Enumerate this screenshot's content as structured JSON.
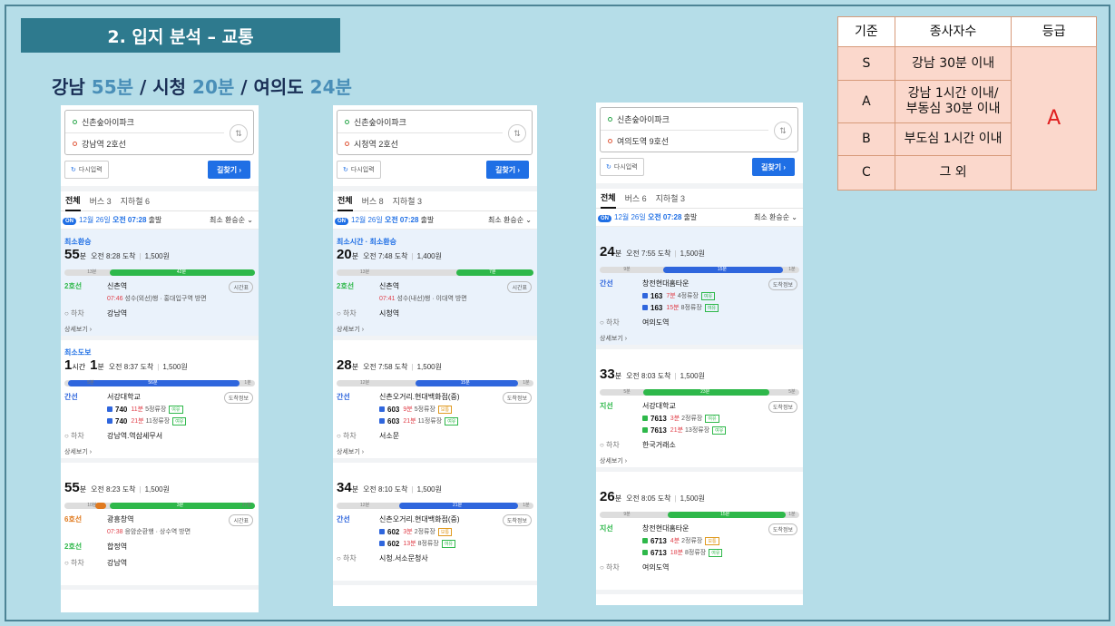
{
  "slide": {
    "title": "2. 입지 분석 – 교통",
    "summary": [
      {
        "name": "강남",
        "time": "55분",
        "sep": " / "
      },
      {
        "name": "시청",
        "time": "20분",
        "sep": " / "
      },
      {
        "name": "여의도",
        "time": "24분",
        "sep": ""
      }
    ]
  },
  "criteria": {
    "headers": [
      "기준",
      "종사자수",
      "등급"
    ],
    "rows": [
      {
        "level": "S",
        "desc": "강남 30분 이내"
      },
      {
        "level": "A",
        "desc": "강남 1시간 이내/ 부동심 30분 이내"
      },
      {
        "level": "B",
        "desc": "부도심 1시간 이내"
      },
      {
        "level": "C",
        "desc": "그 외"
      }
    ],
    "grade": "A"
  },
  "panels": [
    {
      "origin": "신촌숲아이파크",
      "destination": "강남역 2호선",
      "reset_label": "다시입력",
      "search_label": "길찾기 ›",
      "tabs": [
        "전체",
        "버스 3",
        "지하철 6"
      ],
      "on_badge": "ON",
      "date": "12월 26일",
      "time": "오전 07:28",
      "depart": "출발",
      "sort": "최소 환승순 ⌄",
      "routes": [
        {
          "tag": "최소환승",
          "num1": "55",
          "unit1": "분",
          "num2": "",
          "unit2": "",
          "arrive": "오전 8:28 도착",
          "fare": "1,500원",
          "bar_label_a": "13분",
          "bar_label_b": "42분",
          "steps": [
            {
              "line": "2호선",
              "station": "신촌역",
              "sub_red": "07:46",
              "sub": " 성수(외선)행 · 홍대입구역 방면",
              "pill": "시간표"
            },
            {
              "line": "○ 하차",
              "station": "강남역",
              "sub_red": "",
              "sub": "",
              "pill": ""
            }
          ],
          "more": "상세보기 ›"
        },
        {
          "tag": "최소도보",
          "num1": "1",
          "unit1": "시간",
          "num2": "1",
          "unit2": "분",
          "arrive": "오전 8:37 도착",
          "fare": "1,500원",
          "bar_label_a": "5분",
          "bar_label_b": "56분",
          "bar_label_c": "1분",
          "steps": [
            {
              "line": "간선",
              "station": "서강대학교",
              "sub_red": "",
              "sub": "",
              "pill": "도착정보",
              "buses": [
                {
                  "no": "740",
                  "min": "11분",
                  "info": "5정류장",
                  "tag": "여유"
                },
                {
                  "no": "740",
                  "min": "21분",
                  "info": "11정류장",
                  "tag": "여유"
                }
              ]
            },
            {
              "line": "○ 하차",
              "station": "강남역.역삼세무서",
              "sub_red": "",
              "sub": "",
              "pill": ""
            }
          ],
          "more": "상세보기 ›"
        },
        {
          "tag": "",
          "num1": "55",
          "unit1": "분",
          "num2": "",
          "unit2": "",
          "arrive": "오전 8:23 도착",
          "fare": "1,500원",
          "bar_label_a": "10분",
          "bar_label_b": "3분",
          "bar_label_c": "37분",
          "steps": [
            {
              "line": "6호선",
              "station": "광흥창역",
              "sub_red": "07:38",
              "sub": " 응암순환행 · 상수역 방면",
              "pill": "시간표"
            },
            {
              "line": "2호선",
              "station": "합정역",
              "sub_red": "",
              "sub": "",
              "pill": ""
            },
            {
              "line": "○ 하차",
              "station": "강남역",
              "sub_red": "",
              "sub": "",
              "pill": ""
            }
          ],
          "more": ""
        }
      ]
    },
    {
      "origin": "신촌숲아이파크",
      "destination": "시청역 2호선",
      "reset_label": "다시입력",
      "search_label": "길찾기 ›",
      "tabs": [
        "전체",
        "버스 8",
        "지하철 3"
      ],
      "on_badge": "ON",
      "date": "12월 26일",
      "time": "오전 07:28",
      "depart": "출발",
      "sort": "최소 환승순 ⌄",
      "routes": [
        {
          "tag": "최소시간 · 최소환승",
          "num1": "20",
          "unit1": "분",
          "num2": "",
          "unit2": "",
          "arrive": "오전 7:48 도착",
          "fare": "1,400원",
          "bar_label_a": "13분",
          "bar_label_b": "7분",
          "steps": [
            {
              "line": "2호선",
              "station": "신촌역",
              "sub_red": "07:41",
              "sub": " 성수(내선)행 · 이대역 방면",
              "pill": "시간표"
            },
            {
              "line": "○ 하차",
              "station": "시청역",
              "sub_red": "",
              "sub": "",
              "pill": ""
            }
          ],
          "more": "상세보기 ›"
        },
        {
          "tag": "",
          "num1": "28",
          "unit1": "분",
          "num2": "",
          "unit2": "",
          "arrive": "오전 7:58 도착",
          "fare": "1,500원",
          "bar_label_a": "12분",
          "bar_label_b": "15분",
          "bar_label_c": "1분",
          "steps": [
            {
              "line": "간선",
              "station": "신촌오거리.현대백화점(중)",
              "sub_red": "",
              "sub": "",
              "pill": "도착정보",
              "buses": [
                {
                  "no": "603",
                  "min": "9분",
                  "info": "5정류장",
                  "tag": "보통"
                },
                {
                  "no": "603",
                  "min": "21분",
                  "info": "11정류장",
                  "tag": "여유"
                }
              ]
            },
            {
              "line": "○ 하차",
              "station": "서소문",
              "sub_red": "",
              "sub": "",
              "pill": ""
            }
          ],
          "more": "상세보기 ›"
        },
        {
          "tag": "",
          "num1": "34",
          "unit1": "분",
          "num2": "",
          "unit2": "",
          "arrive": "오전 8:10 도착",
          "fare": "1,500원",
          "bar_label_a": "12분",
          "bar_label_b": "21분",
          "bar_label_c": "1분",
          "steps": [
            {
              "line": "간선",
              "station": "신촌오거리.현대백화점(중)",
              "sub_red": "",
              "sub": "",
              "pill": "도착정보",
              "buses": [
                {
                  "no": "602",
                  "min": "3분",
                  "info": "2정류장",
                  "tag": "보통"
                },
                {
                  "no": "602",
                  "min": "13분",
                  "info": "8정류장",
                  "tag": "여유"
                }
              ]
            },
            {
              "line": "○ 하차",
              "station": "시청.서소문청사",
              "sub_red": "",
              "sub": "",
              "pill": ""
            }
          ],
          "more": ""
        }
      ]
    },
    {
      "origin": "신촌숲아이파크",
      "destination": "여의도역 9호선",
      "reset_label": "다시입력",
      "search_label": "길찾기 ›",
      "tabs": [
        "전체",
        "버스 6",
        "지하철 3"
      ],
      "on_badge": "ON",
      "date": "12월 26일",
      "time": "오전 07:28",
      "depart": "출발",
      "sort": "최소 환승순 ⌄",
      "routes": [
        {
          "tag": "",
          "num1": "24",
          "unit1": "분",
          "num2": "",
          "unit2": "",
          "arrive": "오전 7:55 도착",
          "fare": "1,500원",
          "bar_label_a": "9분",
          "bar_label_b": "15분",
          "bar_label_c": "1분",
          "steps": [
            {
              "line": "간선",
              "station": "창전현대홈타운",
              "sub_red": "",
              "sub": "",
              "pill": "도착정보",
              "buses": [
                {
                  "no": "163",
                  "min": "7분",
                  "info": "4정류장",
                  "tag": "여유"
                },
                {
                  "no": "163",
                  "min": "15분",
                  "info": "8정류장",
                  "tag": "여유"
                }
              ]
            },
            {
              "line": "○ 하차",
              "station": "여의도역",
              "sub_red": "",
              "sub": "",
              "pill": ""
            }
          ],
          "more": "상세보기 ›"
        },
        {
          "tag": "",
          "num1": "33",
          "unit1": "분",
          "num2": "",
          "unit2": "",
          "arrive": "오전 8:03 도착",
          "fare": "1,500원",
          "bar_label_a": "5분",
          "bar_label_b": "23분",
          "bar_label_c": "5분",
          "steps": [
            {
              "line": "지선",
              "station": "서강대학교",
              "sub_red": "",
              "sub": "",
              "pill": "도착정보",
              "buses": [
                {
                  "no": "7613",
                  "min": "3분",
                  "info": "2정류장",
                  "tag": "여유"
                },
                {
                  "no": "7613",
                  "min": "21분",
                  "info": "13정류장",
                  "tag": "여유"
                }
              ]
            },
            {
              "line": "○ 하차",
              "station": "한국거래소",
              "sub_red": "",
              "sub": "",
              "pill": ""
            }
          ],
          "more": "상세보기 ›"
        },
        {
          "tag": "",
          "num1": "26",
          "unit1": "분",
          "num2": "",
          "unit2": "",
          "arrive": "오전 8:05 도착",
          "fare": "1,500원",
          "bar_label_a": "9분",
          "bar_label_b": "15분",
          "bar_label_c": "1분",
          "steps": [
            {
              "line": "지선",
              "station": "창전현대홈타운",
              "sub_red": "",
              "sub": "",
              "pill": "도착정보",
              "buses": [
                {
                  "no": "6713",
                  "min": "4분",
                  "info": "2정류장",
                  "tag": "보통"
                },
                {
                  "no": "6713",
                  "min": "18분",
                  "info": "8정류장",
                  "tag": "여유"
                }
              ]
            },
            {
              "line": "○ 하차",
              "station": "여의도역",
              "sub_red": "",
              "sub": "",
              "pill": ""
            }
          ],
          "more": ""
        }
      ]
    }
  ]
}
